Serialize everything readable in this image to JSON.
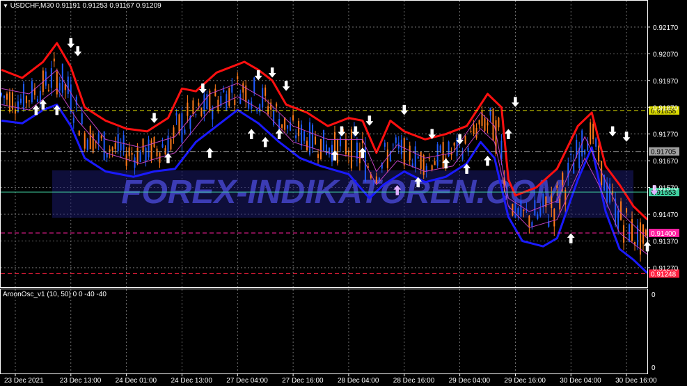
{
  "header": {
    "symbol_line": "USDCHF,M30  0.91191 0.91253 0.91167 0.91209"
  },
  "indicator": {
    "label": "AroonOsc_v1 (10, 50) 0 0 -40 -40",
    "scale_top": "0",
    "scale_bottom": "0"
  },
  "watermark": "FOREX-INDIKATOREN.COM",
  "colors": {
    "background": "#000000",
    "frame": "#ffffff",
    "grid": "#8a8a8a",
    "upper_band": "#ff1010",
    "lower_band": "#1a1aff",
    "inner_band": "#c040c0",
    "candle_up": "#1e5aff",
    "candle_down": "#ff7a1a",
    "arrow": "#ffffff",
    "arrow_light": "#e0b0ff",
    "level_yellow": "#d8d800",
    "level_gray": "#a0a0a0",
    "level_green": "#40d0a0",
    "level_magenta": "#ff20a0",
    "level_red": "#ff2040",
    "watermark": "#3c3cb4"
  },
  "chart_data": {
    "type": "line",
    "title": "USDCHF,M30",
    "ylim": [
      0.9121,
      0.9224
    ],
    "y_ticks": [
      "0.92170",
      "0.92070",
      "0.91970",
      "0.91870",
      "0.91770",
      "0.91670",
      "0.91570",
      "0.91470",
      "0.91370",
      "0.91270"
    ],
    "x_ticks": [
      {
        "x": 1,
        "label": "23 Dec 2021"
      },
      {
        "x": 9,
        "label": "23 Dec 13:00"
      },
      {
        "x": 17,
        "label": "24 Dec 01:00"
      },
      {
        "x": 25,
        "label": "24 Dec 13:00"
      },
      {
        "x": 33,
        "label": "27 Dec 04:00"
      },
      {
        "x": 41,
        "label": "27 Dec 16:00"
      },
      {
        "x": 49,
        "label": "28 Dec 04:00"
      },
      {
        "x": 57,
        "label": "28 Dec 16:00"
      },
      {
        "x": 65,
        "label": "29 Dec 04:00"
      },
      {
        "x": 73,
        "label": "29 Dec 16:00"
      },
      {
        "x": 81,
        "label": "30 Dec 04:00"
      },
      {
        "x": 89,
        "label": "30 Dec 16:00"
      }
    ],
    "x_range": [
      0,
      93
    ],
    "levels": [
      {
        "label": "0.91858",
        "value": 0.91858,
        "color": "#d8d800",
        "text_color": "#000",
        "style": "dash"
      },
      {
        "label": "0.91705",
        "value": 0.91705,
        "color": "#a0a0a0",
        "text_color": "#000",
        "style": "dashdot"
      },
      {
        "label": "0.91553",
        "value": 0.91553,
        "color": "#40d0a0",
        "text_color": "#000",
        "style": "solid"
      },
      {
        "label": "0.91400",
        "value": 0.914,
        "color": "#ff20a0",
        "text_color": "#fff",
        "style": "dash"
      },
      {
        "label": "0.91248",
        "value": 0.91248,
        "color": "#ff2040",
        "text_color": "#fff",
        "style": "dash"
      }
    ],
    "series": [
      {
        "name": "upper",
        "color": "#ff1010",
        "points": [
          [
            0,
            0.9201
          ],
          [
            3,
            0.9198
          ],
          [
            6,
            0.9204
          ],
          [
            8,
            0.9211
          ],
          [
            10,
            0.9202
          ],
          [
            12,
            0.9187
          ],
          [
            15,
            0.9182
          ],
          [
            18,
            0.9179
          ],
          [
            21,
            0.9178
          ],
          [
            24,
            0.9183
          ],
          [
            26,
            0.9194
          ],
          [
            28,
            0.9193
          ],
          [
            31,
            0.92
          ],
          [
            35,
            0.9204
          ],
          [
            37,
            0.9201
          ],
          [
            39,
            0.9197
          ],
          [
            41,
            0.9188
          ],
          [
            44,
            0.9185
          ],
          [
            47,
            0.918
          ],
          [
            50,
            0.9183
          ],
          [
            52,
            0.9182
          ],
          [
            54,
            0.917
          ],
          [
            56,
            0.9182
          ],
          [
            58,
            0.9178
          ],
          [
            61,
            0.9175
          ],
          [
            64,
            0.9177
          ],
          [
            67,
            0.918
          ],
          [
            70,
            0.9192
          ],
          [
            72,
            0.9187
          ],
          [
            73,
            0.916
          ],
          [
            74,
            0.9154
          ],
          [
            77,
            0.9157
          ],
          [
            80,
            0.9164
          ],
          [
            83,
            0.918
          ],
          [
            85,
            0.9185
          ],
          [
            87,
            0.9165
          ],
          [
            89,
            0.9158
          ],
          [
            91,
            0.915
          ],
          [
            93,
            0.9145
          ]
        ]
      },
      {
        "name": "lower",
        "color": "#1a1aff",
        "points": [
          [
            0,
            0.9182
          ],
          [
            3,
            0.9181
          ],
          [
            6,
            0.9186
          ],
          [
            8,
            0.9188
          ],
          [
            10,
            0.918
          ],
          [
            12,
            0.9168
          ],
          [
            15,
            0.9163
          ],
          [
            19,
            0.9161
          ],
          [
            22,
            0.9163
          ],
          [
            25,
            0.9164
          ],
          [
            28,
            0.9174
          ],
          [
            31,
            0.918
          ],
          [
            34,
            0.9186
          ],
          [
            37,
            0.9181
          ],
          [
            40,
            0.9174
          ],
          [
            43,
            0.9168
          ],
          [
            46,
            0.9165
          ],
          [
            50,
            0.9162
          ],
          [
            53,
            0.9153
          ],
          [
            55,
            0.9158
          ],
          [
            58,
            0.9163
          ],
          [
            61,
            0.9159
          ],
          [
            64,
            0.9161
          ],
          [
            67,
            0.9166
          ],
          [
            69,
            0.9174
          ],
          [
            71,
            0.9168
          ],
          [
            73,
            0.9146
          ],
          [
            75,
            0.9137
          ],
          [
            78,
            0.9135
          ],
          [
            80,
            0.9138
          ],
          [
            83,
            0.916
          ],
          [
            85,
            0.9172
          ],
          [
            87,
            0.9148
          ],
          [
            89,
            0.9134
          ],
          [
            91,
            0.913
          ],
          [
            93,
            0.9125
          ]
        ]
      },
      {
        "name": "mid_upper",
        "color": "#c040c0",
        "points": [
          [
            0,
            0.9194
          ],
          [
            4,
            0.9192
          ],
          [
            8,
            0.9201
          ],
          [
            11,
            0.9188
          ],
          [
            15,
            0.9175
          ],
          [
            20,
            0.9172
          ],
          [
            25,
            0.9176
          ],
          [
            30,
            0.9192
          ],
          [
            34,
            0.9196
          ],
          [
            38,
            0.919
          ],
          [
            42,
            0.918
          ],
          [
            47,
            0.9175
          ],
          [
            52,
            0.9175
          ],
          [
            54,
            0.9163
          ],
          [
            57,
            0.9173
          ],
          [
            61,
            0.9168
          ],
          [
            65,
            0.917
          ],
          [
            69,
            0.9185
          ],
          [
            71,
            0.918
          ],
          [
            73,
            0.9153
          ],
          [
            76,
            0.9148
          ],
          [
            80,
            0.9152
          ],
          [
            84,
            0.9176
          ],
          [
            86,
            0.9165
          ],
          [
            89,
            0.9148
          ],
          [
            93,
            0.9138
          ]
        ]
      },
      {
        "name": "mid_lower",
        "color": "#c040c0",
        "points": [
          [
            0,
            0.9188
          ],
          [
            4,
            0.9186
          ],
          [
            8,
            0.9194
          ],
          [
            11,
            0.9182
          ],
          [
            15,
            0.917
          ],
          [
            20,
            0.9166
          ],
          [
            25,
            0.917
          ],
          [
            30,
            0.9186
          ],
          [
            34,
            0.9191
          ],
          [
            38,
            0.9185
          ],
          [
            42,
            0.9174
          ],
          [
            47,
            0.917
          ],
          [
            52,
            0.9168
          ],
          [
            54,
            0.9158
          ],
          [
            57,
            0.9167
          ],
          [
            61,
            0.9163
          ],
          [
            65,
            0.9165
          ],
          [
            69,
            0.9179
          ],
          [
            71,
            0.9174
          ],
          [
            73,
            0.915
          ],
          [
            76,
            0.9142
          ],
          [
            80,
            0.9145
          ],
          [
            84,
            0.9168
          ],
          [
            86,
            0.9158
          ],
          [
            89,
            0.914
          ],
          [
            93,
            0.9132
          ]
        ]
      }
    ],
    "arrows": [
      {
        "x": 5,
        "y": 0.9186,
        "dir": "up"
      },
      {
        "x": 6,
        "y": 0.9188,
        "dir": "up"
      },
      {
        "x": 8,
        "y": 0.9186,
        "dir": "up"
      },
      {
        "x": 10,
        "y": 0.9211,
        "dir": "down"
      },
      {
        "x": 11,
        "y": 0.9208,
        "dir": "down"
      },
      {
        "x": 22,
        "y": 0.9183,
        "dir": "down"
      },
      {
        "x": 24,
        "y": 0.9168,
        "dir": "up"
      },
      {
        "x": 29,
        "y": 0.9194,
        "dir": "down"
      },
      {
        "x": 30,
        "y": 0.917,
        "dir": "up"
      },
      {
        "x": 36,
        "y": 0.9177,
        "dir": "up"
      },
      {
        "x": 37,
        "y": 0.9199,
        "dir": "down"
      },
      {
        "x": 38,
        "y": 0.9174,
        "dir": "up"
      },
      {
        "x": 39,
        "y": 0.92,
        "dir": "down"
      },
      {
        "x": 40,
        "y": 0.9177,
        "dir": "up"
      },
      {
        "x": 41,
        "y": 0.9195,
        "dir": "down"
      },
      {
        "x": 48,
        "y": 0.9169,
        "dir": "up"
      },
      {
        "x": 49,
        "y": 0.9178,
        "dir": "down"
      },
      {
        "x": 51,
        "y": 0.9178,
        "dir": "down"
      },
      {
        "x": 52,
        "y": 0.917,
        "dir": "up"
      },
      {
        "x": 53,
        "y": 0.9182,
        "dir": "down"
      },
      {
        "x": 57,
        "y": 0.9156,
        "dir": "up",
        "light": true
      },
      {
        "x": 58,
        "y": 0.9186,
        "dir": "down"
      },
      {
        "x": 60,
        "y": 0.9159,
        "dir": "up"
      },
      {
        "x": 62,
        "y": 0.9177,
        "dir": "down"
      },
      {
        "x": 64,
        "y": 0.9166,
        "dir": "up"
      },
      {
        "x": 66,
        "y": 0.9175,
        "dir": "down"
      },
      {
        "x": 67,
        "y": 0.9164,
        "dir": "up"
      },
      {
        "x": 70,
        "y": 0.9167,
        "dir": "up"
      },
      {
        "x": 73,
        "y": 0.9177,
        "dir": "up"
      },
      {
        "x": 74,
        "y": 0.9189,
        "dir": "down"
      },
      {
        "x": 82,
        "y": 0.9138,
        "dir": "up"
      },
      {
        "x": 88,
        "y": 0.9178,
        "dir": "down"
      },
      {
        "x": 90,
        "y": 0.9176,
        "dir": "down"
      },
      {
        "x": 93,
        "y": 0.9135,
        "dir": "up"
      },
      {
        "x": 94,
        "y": 0.9156,
        "dir": "down",
        "light": true
      }
    ]
  }
}
